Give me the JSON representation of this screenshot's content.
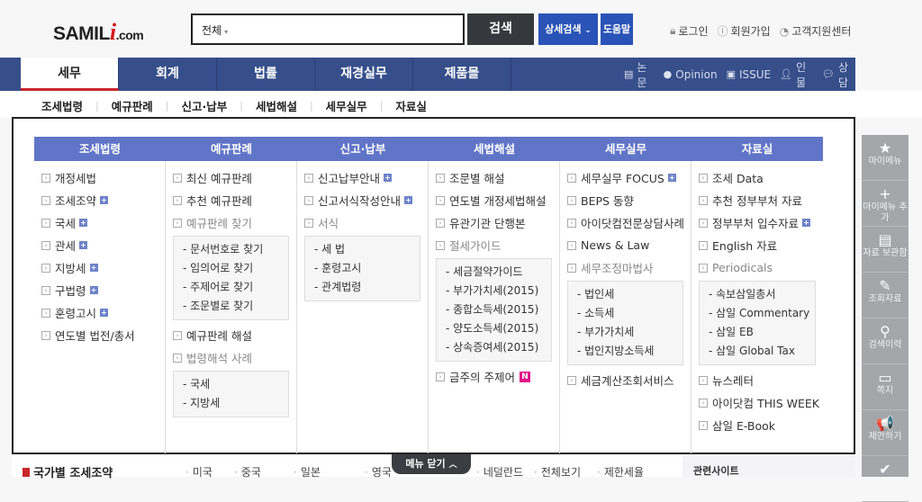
{
  "header": {
    "logo": {
      "main": "SAMIL",
      "i": "i",
      "suffix": ".com"
    },
    "search": {
      "scope": "전체",
      "placeholder": "",
      "value": ""
    },
    "search_button": "검색",
    "detail_search_button": "상세검색",
    "help_button": "도움말",
    "util_links": [
      {
        "icon": "lock-icon",
        "label": "로그인"
      },
      {
        "icon": "user-circle-icon",
        "label": "회원가입"
      },
      {
        "icon": "support-icon",
        "label": "고객지원센터"
      }
    ]
  },
  "nav": {
    "tabs": [
      {
        "label": "세무",
        "active": true
      },
      {
        "label": "회계"
      },
      {
        "label": "법률"
      },
      {
        "label": "재경실무"
      },
      {
        "label": "제품몰"
      }
    ],
    "right_links": [
      {
        "icon": "document-icon",
        "label": "논문"
      },
      {
        "icon": "bulb-icon",
        "label": "Opinion"
      },
      {
        "icon": "flag-icon",
        "label": "ISSUE"
      },
      {
        "icon": "person-icon",
        "label": "인물"
      },
      {
        "icon": "chat-icon",
        "label": "상담"
      }
    ]
  },
  "subnav": [
    "조세법령",
    "예규판례",
    "신고·납부",
    "세법해설",
    "세무실무",
    "자료실"
  ],
  "mega_menu": {
    "columns": [
      {
        "title": "조세법령",
        "items": [
          {
            "label": "개정세법"
          },
          {
            "label": "조세조약",
            "plus": true
          },
          {
            "label": "국세",
            "plus": true
          },
          {
            "label": "관세",
            "plus": true
          },
          {
            "label": "지방세",
            "plus": true
          },
          {
            "label": "구법령",
            "plus": true
          },
          {
            "label": "훈령고시",
            "plus": true
          },
          {
            "label": "연도별 법전/총서"
          }
        ]
      },
      {
        "title": "예규판례",
        "items": [
          {
            "label": "최신 예규판례"
          },
          {
            "label": "추천 예규판례"
          },
          {
            "label": "예규판례 찾기",
            "gray": true,
            "sub": [
              "- 문서번호로 찾기",
              "- 임의어로 찾기",
              "- 주제어로 찾기",
              "- 조문별로 찾기"
            ]
          },
          {
            "label": "예규판례 해설"
          },
          {
            "label": "법령해석 사례",
            "gray": true,
            "sub": [
              "- 국세",
              "- 지방세"
            ]
          }
        ]
      },
      {
        "title": "신고·납부",
        "items": [
          {
            "label": "신고납부안내",
            "plus": true
          },
          {
            "label": "신고서식작성안내",
            "plus": true
          },
          {
            "label": "서식",
            "gray": true,
            "sub": [
              "- 세 법",
              "- 훈령고시",
              "- 관계법령"
            ]
          }
        ]
      },
      {
        "title": "세법해설",
        "items": [
          {
            "label": "조문별 해설"
          },
          {
            "label": "연도별 개정세법해설"
          },
          {
            "label": "유관기관 단행본"
          },
          {
            "label": "절세가이드",
            "gray": true,
            "sub": [
              "- 세금절약가이드",
              "- 부가가치세(2015)",
              "- 종합소득세(2015)",
              "- 양도소득세(2015)",
              "- 상속증여세(2015)"
            ]
          },
          {
            "label": "금주의 주제어",
            "new": "N"
          }
        ]
      },
      {
        "title": "세무실무",
        "items": [
          {
            "label": "세무실무 FOCUS",
            "plus": true
          },
          {
            "label": "BEPS 동향"
          },
          {
            "label": "아이닷컴전문상담사례"
          },
          {
            "label": "News & Law"
          },
          {
            "label": "세무조정마법사",
            "gray": true,
            "sub": [
              "- 법인세",
              "- 소득세",
              "- 부가가치세",
              "- 법인지방소득세"
            ]
          },
          {
            "label": "세금계산조회서비스"
          }
        ]
      },
      {
        "title": "자료실",
        "items": [
          {
            "label": "조세 Data"
          },
          {
            "label": "추천 정부부처 자료"
          },
          {
            "label": "정부부처 입수자료",
            "plus": true
          },
          {
            "label": "English 자료"
          },
          {
            "label": "Periodicals",
            "gray": true,
            "sub": [
              "- 속보삼일총서",
              "- 삼일 Commentary",
              "- 삼일 EB",
              "- 삼일 Global Tax"
            ]
          },
          {
            "label": "뉴스레터"
          },
          {
            "label": "아이닷컴 THIS WEEK"
          },
          {
            "label": "삼일 E-Book"
          }
        ]
      }
    ],
    "close_label": "메뉴 닫기"
  },
  "quick_menu": [
    {
      "icon": "star-icon",
      "glyph": "★",
      "label": "마이메뉴"
    },
    {
      "icon": "plus-icon",
      "glyph": "+",
      "label": "마이메뉴 추가"
    },
    {
      "icon": "file-icon",
      "glyph": "▤",
      "label": "자료 보관함"
    },
    {
      "icon": "pencil-icon",
      "glyph": "✎",
      "label": "조회자료"
    },
    {
      "icon": "magnifier-icon",
      "glyph": "⚲",
      "label": "검색이력"
    },
    {
      "icon": "message-icon",
      "glyph": "▭",
      "label": "쪽지"
    },
    {
      "icon": "megaphone-icon",
      "glyph": "📢",
      "label": "제안하기"
    },
    {
      "icon": "check-circle-icon",
      "glyph": "✔",
      "label": ""
    }
  ],
  "bottom": {
    "section_title": "국가별 조세조약",
    "countries": [
      "미국",
      "중국",
      "일본",
      "영국",
      "네덜란드",
      "전체보기",
      "제한세율"
    ],
    "related_title": "관련사이트"
  }
}
